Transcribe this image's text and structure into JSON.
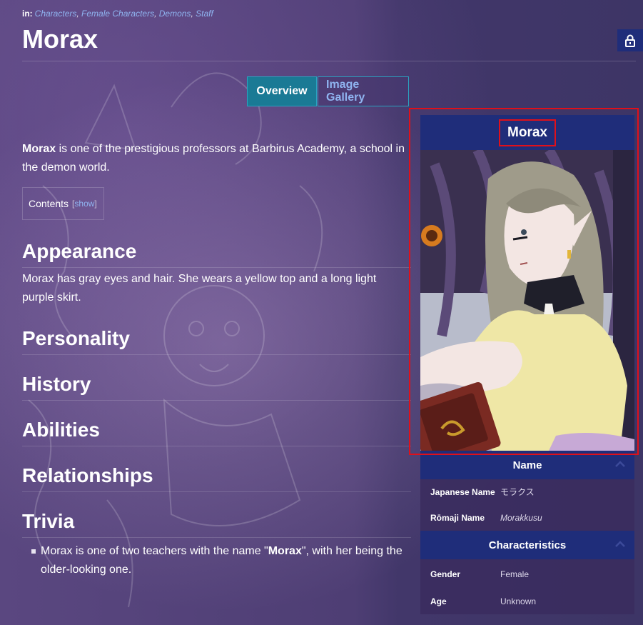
{
  "categories": {
    "prefix": "in:",
    "links": [
      "Characters",
      "Female Characters",
      "Demons",
      "Staff"
    ]
  },
  "page_title": "Morax",
  "tabs": [
    {
      "label": "Overview",
      "active": true
    },
    {
      "label": "Image Gallery",
      "active": false
    }
  ],
  "lead": {
    "name": "Morax",
    "text": " is one of the prestigious professors at Barbirus Academy, a school in the demon world."
  },
  "toc": {
    "label": "Contents",
    "open_bracket": "[",
    "toggle": "show",
    "close_bracket": "]"
  },
  "sections": {
    "appearance": {
      "heading": "Appearance",
      "text": "Morax has gray eyes and hair. She wears a yellow top and a long light purple skirt."
    },
    "personality": {
      "heading": "Personality"
    },
    "history": {
      "heading": "History"
    },
    "abilities": {
      "heading": "Abilities"
    },
    "relationships": {
      "heading": "Relationships"
    },
    "trivia": {
      "heading": "Trivia",
      "item_pre": "Morax is one of two teachers with the name \"",
      "item_bold": "Morax",
      "item_post": "\", with her being the older-looking one."
    }
  },
  "infobox": {
    "title": "Morax",
    "name_header": "Name",
    "japanese_name_label": "Japanese Name",
    "japanese_name_value": "モラクス",
    "romaji_label": "Rōmaji Name",
    "romaji_value": "Morakkusu",
    "characteristics_header": "Characteristics",
    "gender_label": "Gender",
    "gender_value": "Female",
    "age_label": "Age",
    "age_value": "Unknown"
  },
  "colors": {
    "accent_blue": "#1f2d7a",
    "tab_active": "#1a7a95",
    "link": "#8fb4f0",
    "highlight_red": "#e0101a"
  },
  "icons": {
    "lock": "lock-icon",
    "collapse": "chevron-up-icon"
  }
}
